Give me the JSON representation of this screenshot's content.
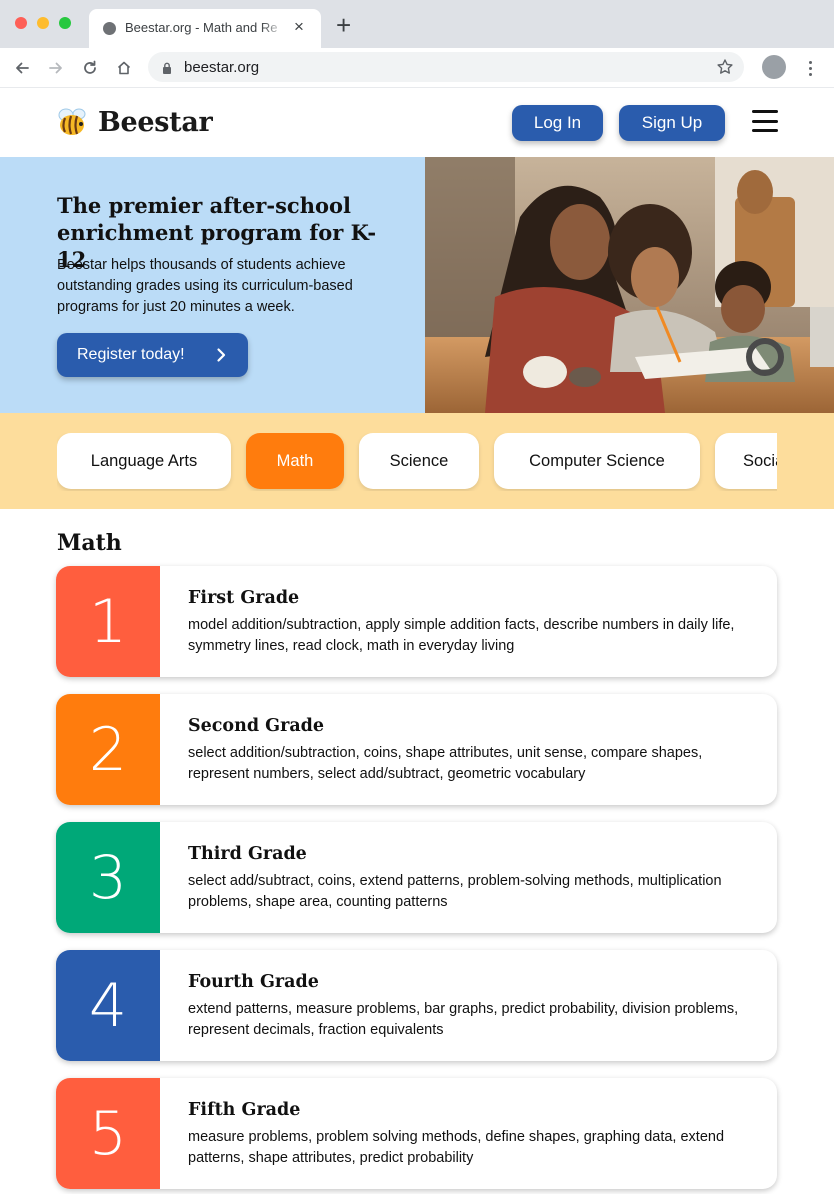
{
  "browser": {
    "tab_title": "Beestar.org - Math and Re",
    "tab_close": "×",
    "new_tab": "+",
    "url": "beestar.org"
  },
  "header": {
    "logo_text": "Beestar",
    "login_label": "Log In",
    "signup_label": "Sign Up"
  },
  "hero": {
    "title": "The premier after-school enrichment program for K-12",
    "description": "Beestar helps thousands of students achieve outstanding grades using its curriculum-based programs for just 20 minutes a week.",
    "cta_label": "Register today!"
  },
  "subjects": [
    {
      "label": "Language Arts",
      "active": false
    },
    {
      "label": "Math",
      "active": true
    },
    {
      "label": "Science",
      "active": false
    },
    {
      "label": "Computer Science",
      "active": false
    },
    {
      "label": "Social Studies",
      "active": false
    }
  ],
  "section": {
    "title": "Math"
  },
  "grades": [
    {
      "number": "1",
      "title": "First Grade",
      "color": "#ff5e3e",
      "description": "model addition/subtraction, apply simple addition facts, describe numbers in daily life, symmetry lines, read clock, math in everyday living"
    },
    {
      "number": "2",
      "title": "Second Grade",
      "color": "#ff7c0d",
      "description": "select addition/subtraction, coins, shape attributes, unit sense, compare shapes, represent numbers, select add/subtract, geometric vocabulary"
    },
    {
      "number": "3",
      "title": "Third Grade",
      "color": "#00a878",
      "description": "select add/subtract, coins, extend patterns, problem-solving methods, multiplication problems, shape area, counting patterns"
    },
    {
      "number": "4",
      "title": "Fourth Grade",
      "color": "#2a5cad",
      "description": "extend patterns, measure problems, bar graphs, predict probability, division problems, represent decimals, fraction equivalents"
    },
    {
      "number": "5",
      "title": "Fifth Grade",
      "color": "#ff5e3e",
      "description": "measure problems, problem solving methods, define shapes, graphing data, extend patterns, shape attributes, predict probability"
    }
  ],
  "colors": {
    "brand_blue": "#2a5cad",
    "active_tab": "#ff7c0d",
    "hero_bg": "#bbdcf7",
    "subjects_bg": "#fddd9c"
  }
}
